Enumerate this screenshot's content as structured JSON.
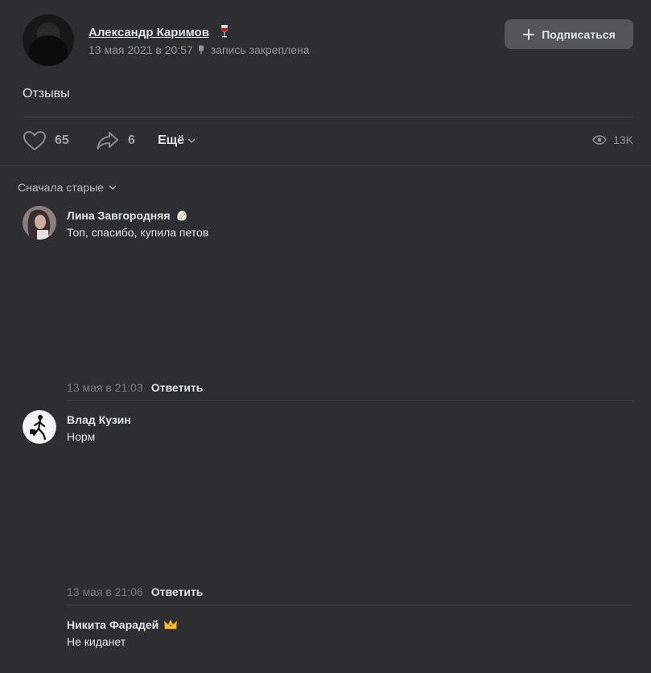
{
  "post": {
    "author": "Александр Каримов",
    "date": "13 мая 2021 в 20:57",
    "pinned_label": "запись закреплена",
    "subscribe_label": "Подписаться",
    "text": "Отзывы",
    "likes": "65",
    "shares": "6",
    "more_label": "Ещё",
    "views": "13K"
  },
  "comments_sort": "Сначала старые",
  "comments": [
    {
      "author": "Лина Завгородняя",
      "text": "Топ, спасибо, купила петов",
      "date": "13 мая в 21:03",
      "reply": "Ответить"
    },
    {
      "author": "Влад Кузин",
      "text": "Норм",
      "date": "13 мая в 21:06",
      "reply": "Ответить"
    },
    {
      "author": "Никита Фарадей",
      "text": "Не киданет"
    }
  ],
  "colors": {
    "background": "#2e2e30",
    "button": "#555557",
    "text": "#e1e3e6",
    "secondary_text": "#939393"
  },
  "icons": [
    "wine-glass-icon",
    "pin-icon",
    "plus-icon",
    "heart-icon",
    "share-icon",
    "chevron-down-icon",
    "eye-icon",
    "shell-emoji-icon",
    "crown-emoji-icon"
  ]
}
